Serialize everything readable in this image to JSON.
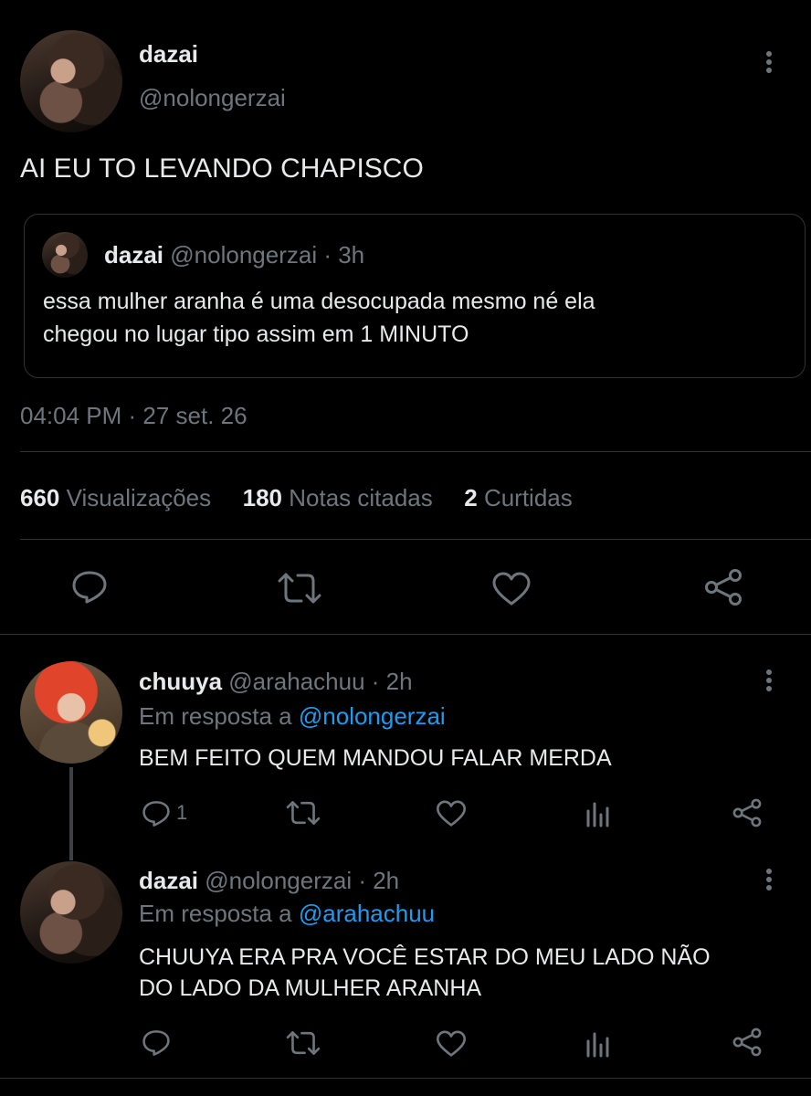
{
  "main_tweet": {
    "display_name": "dazai",
    "handle": "@nolongerzai",
    "text": "AI EU TO LEVANDO CHAPISCO",
    "quoted": {
      "display_name": "dazai",
      "handle": "@nolongerzai",
      "time": "· 3h",
      "text_line1": "essa mulher aranha é uma desocupada mesmo né ela",
      "text_line2": "chegou no lugar tipo assim em 1 MINUTO"
    },
    "timestamp": "04:04 PM · 27 set. 26",
    "stats": {
      "views_count": "660",
      "views_label": "Visualizações",
      "quotes_count": "180",
      "quotes_label": "Notas citadas",
      "likes_count": "2",
      "likes_label": "Curtidas"
    },
    "actions": [
      "reply-icon",
      "retweet-icon",
      "like-icon",
      "share-icon"
    ]
  },
  "replies": [
    {
      "display_name": "chuuya",
      "handle": "@arahachuu",
      "time": "· 2h",
      "reply_prefix": "Em resposta a",
      "reply_to": "@nolongerzai",
      "text_line1": "BEM FEITO QUEM MANDOU FALAR MERDA",
      "text_line2": "",
      "reply_count": "1"
    },
    {
      "display_name": "dazai",
      "handle": "@nolongerzai",
      "time": "· 2h",
      "reply_prefix": "Em resposta a",
      "reply_to": "@arahachuu",
      "text_line1": "CHUUYA ERA PRA VOCÊ ESTAR DO MEU LADO NÃO",
      "text_line2": "DO LADO DA MULHER ARANHA",
      "reply_count": ""
    }
  ],
  "colors": {
    "background": "#000000",
    "text": "#e7e9ea",
    "muted": "#6e767d",
    "link": "#1d9bf0",
    "divider": "#2f3336"
  }
}
